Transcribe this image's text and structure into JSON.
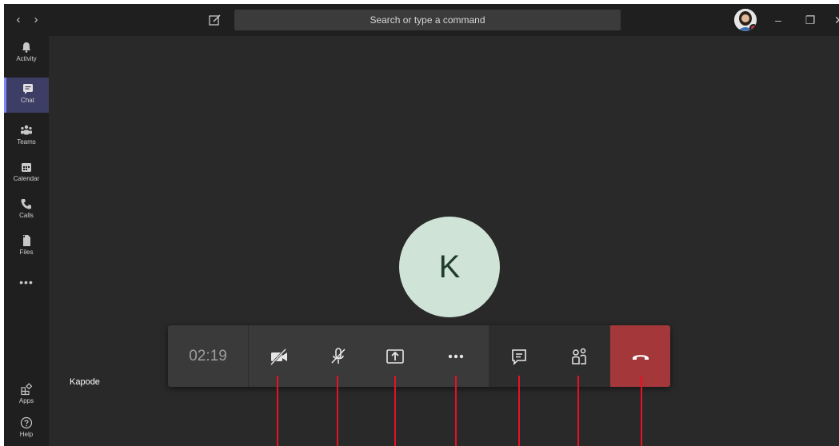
{
  "titlebar": {
    "back": "‹",
    "forward": "›",
    "search_placeholder": "Search or type a command",
    "minimize": "–",
    "maximize": "❐",
    "close": "✕"
  },
  "rail": {
    "items": [
      {
        "label": "Activity",
        "icon": "bell-icon"
      },
      {
        "label": "Chat",
        "icon": "chat-icon",
        "active": true
      },
      {
        "label": "Teams",
        "icon": "teams-icon"
      },
      {
        "label": "Calendar",
        "icon": "calendar-icon"
      },
      {
        "label": "Calls",
        "icon": "phone-icon"
      },
      {
        "label": "Files",
        "icon": "file-icon"
      }
    ],
    "more": "•••",
    "apps_label": "Apps",
    "help_label": "Help"
  },
  "call": {
    "avatar_initial": "K",
    "participant_name": "Kapode",
    "timer": "02:19",
    "controls": [
      {
        "name": "camera-off",
        "icon": "video-off-icon"
      },
      {
        "name": "mic-off",
        "icon": "mic-off-icon"
      },
      {
        "name": "share",
        "icon": "share-screen-icon"
      },
      {
        "name": "more",
        "icon": "more-icon"
      },
      {
        "name": "chat",
        "icon": "chat-icon"
      },
      {
        "name": "participants",
        "icon": "people-icon"
      },
      {
        "name": "hang-up",
        "icon": "hang-up-icon"
      }
    ],
    "hangup_color": "#a4373a"
  },
  "colors": {
    "accent": "#7f85f5",
    "annotation": "#e81123"
  }
}
